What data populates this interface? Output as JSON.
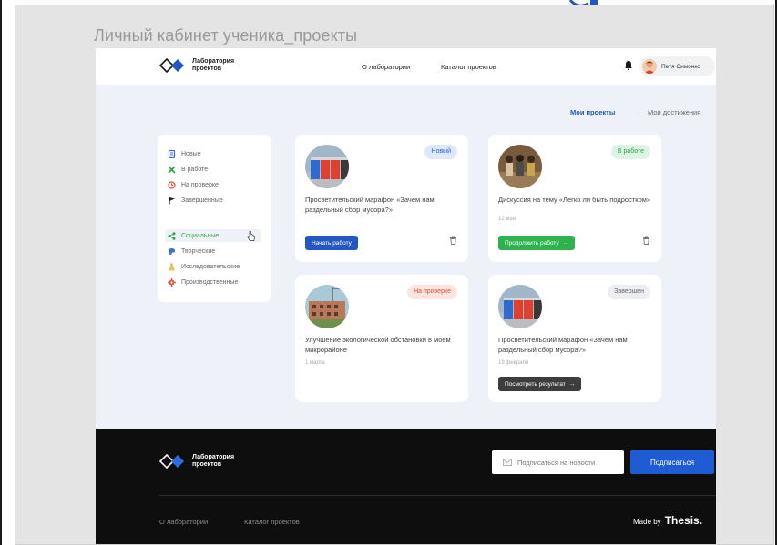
{
  "board": {
    "title": "Личный кабинет ученика_проекты"
  },
  "header": {
    "logo_text": "Лаборатория проектов",
    "nav": {
      "about": "О лаборатории",
      "catalog": "Каталог проектов"
    },
    "user_name": "Петя Симонко"
  },
  "subnav": {
    "my_projects": "Мои проекты",
    "separator": "·",
    "achievements": "Мои достижения"
  },
  "sidebar": {
    "status_items": [
      {
        "label": "Новые",
        "icon": "document-icon",
        "color": "#3d6ed6"
      },
      {
        "label": "В работе",
        "icon": "tools-icon",
        "color": "#2fa54a"
      },
      {
        "label": "На проверке",
        "icon": "review-icon",
        "color": "#e0553c"
      },
      {
        "label": "Завершенные",
        "icon": "flag-icon",
        "color": "#222222"
      }
    ],
    "category_items": [
      {
        "label": "Социальные",
        "icon": "share-icon",
        "color": "#2fa54a",
        "active": true
      },
      {
        "label": "Творческие",
        "icon": "palette-icon",
        "color": "#3d6ed6"
      },
      {
        "label": "Исследовательские",
        "icon": "flask-icon",
        "color": "#e9a521"
      },
      {
        "label": "Производственные",
        "icon": "gear-icon",
        "color": "#e0553c"
      }
    ]
  },
  "cards": [
    {
      "badge": "Новый",
      "title": "Просветительский марафон «Зачем нам раздельный сбор мусора?»",
      "date": "",
      "button": "Начать работу"
    },
    {
      "badge": "В работе",
      "title": "Дискуссия на тему «Легко ли быть подростком»",
      "date": "12 мая",
      "button": "Продолжить работу"
    },
    {
      "badge": "На проверке",
      "title": "Улучшение экологической обстановки в моем микрорайоне",
      "date": "1 марта",
      "button": ""
    },
    {
      "badge": "Завершен",
      "title": "Просветительский марафон «Зачем нам раздельный сбор мусора?»",
      "date": "19 февраля",
      "button": "Посмотреть результат"
    }
  ],
  "footer": {
    "logo_text": "Лаборатория проектов",
    "subscribe_placeholder": "Подписаться на новости",
    "subscribe_button": "Подписаться",
    "links": {
      "about": "О лаборатории",
      "catalog": "Каталог проектов"
    },
    "made_by": "Made by",
    "made_by_brand": "Thesis."
  },
  "colors": {
    "accent_blue": "#2357c4",
    "accent_green": "#2db34d",
    "footer_bg": "#0e0e0e",
    "page_bg": "#eef2f8"
  }
}
